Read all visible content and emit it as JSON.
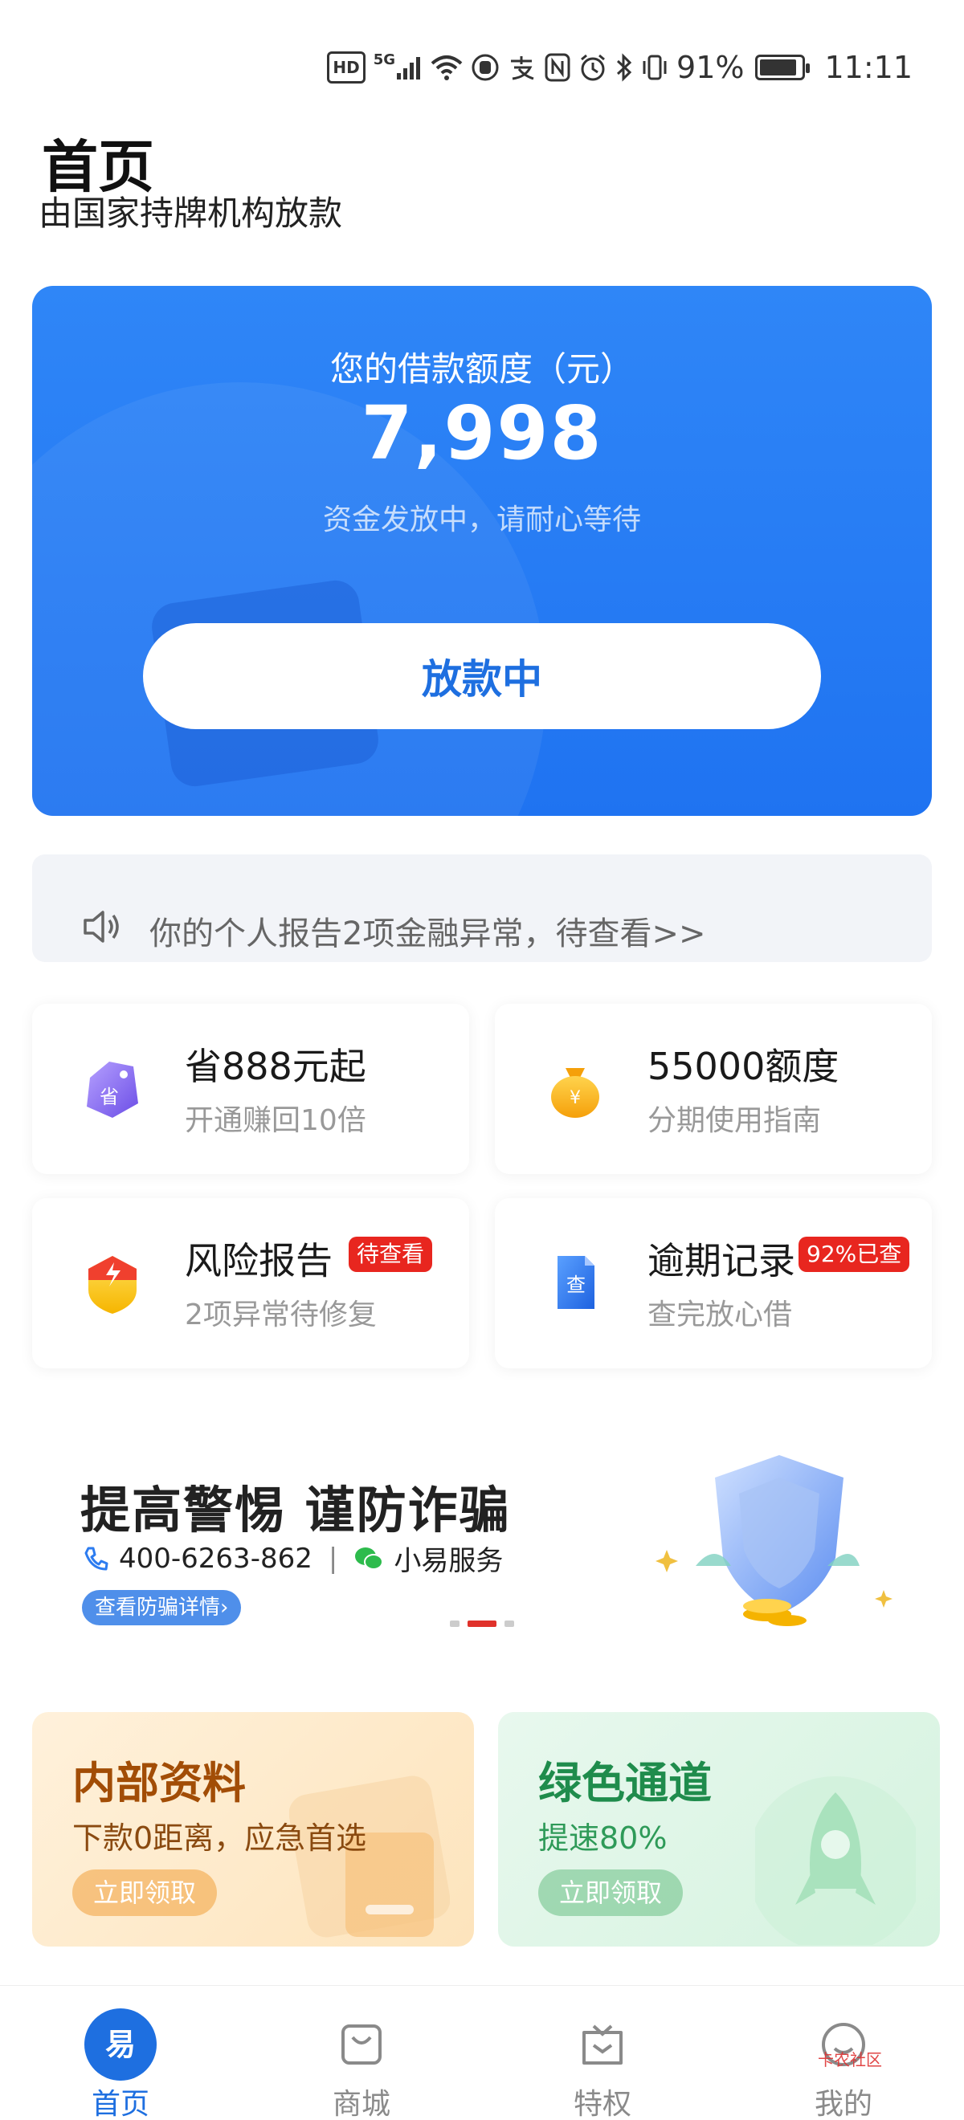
{
  "status_bar": {
    "hd": "HD",
    "network": "5G",
    "battery_percent": "91%",
    "battery_level": 0.91,
    "time": "11:11"
  },
  "header": {
    "title": "首页",
    "subtitle": "由国家持牌机构放款"
  },
  "credit": {
    "label": "您的借款额度（元）",
    "amount": "7,998",
    "status": "资金发放中，请耐心等待",
    "button_label": "放款中"
  },
  "notice": {
    "text": "你的个人报告2项金融异常，待查看>>"
  },
  "features": [
    {
      "title": "省888元起",
      "subtitle": "开通赚回10倍",
      "icon": "tag-icon",
      "badge": ""
    },
    {
      "title": "55000额度",
      "subtitle": "分期使用指南",
      "icon": "money-bag-icon",
      "badge": ""
    },
    {
      "title": "风险报告",
      "subtitle": "2项异常待修复",
      "icon": "shield-icon",
      "badge": "待查看"
    },
    {
      "title": "逾期记录",
      "subtitle": "查完放心借",
      "icon": "document-icon",
      "badge": "92%已查"
    }
  ],
  "banner": {
    "title": "提高警惕 谨防诈骗",
    "phone": "400-6263-862",
    "separator": "|",
    "service": "小易服务",
    "link_label": "查看防骗详情",
    "link_chevron": "›"
  },
  "promos": [
    {
      "title": "内部资料",
      "subtitle": "下款0距离，应急首选",
      "button": "立即领取"
    },
    {
      "title": "绿色通道",
      "subtitle": "提速80%",
      "button": "立即领取"
    }
  ],
  "nav": {
    "items": [
      {
        "label": "首页",
        "icon": "home-icon",
        "icon_char": "易"
      },
      {
        "label": "商城",
        "icon": "shopping-bag-icon"
      },
      {
        "label": "特权",
        "icon": "privilege-icon"
      },
      {
        "label": "我的",
        "icon": "profile-icon"
      }
    ]
  },
  "watermark": "卡农社区",
  "colors": {
    "primary": "#1e6fe0",
    "card_blue": "#2f86f7",
    "badge_red": "#e8261f",
    "promo_orange": "#a24d06",
    "promo_green": "#1f8c4c"
  }
}
